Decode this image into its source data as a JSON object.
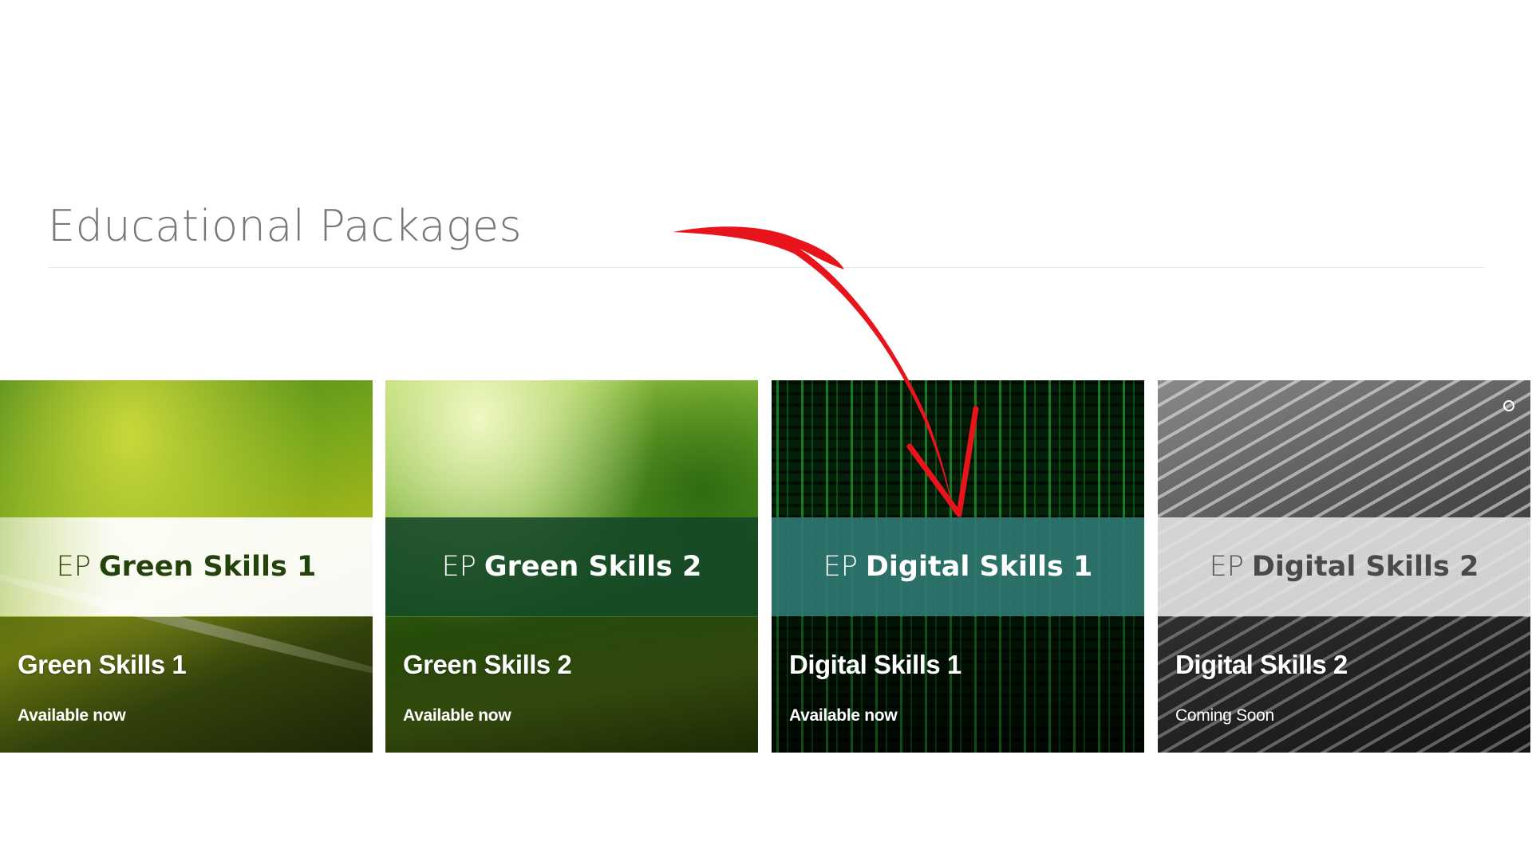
{
  "section": {
    "title": "Educational Packages"
  },
  "cards": [
    {
      "band_prefix": "EP",
      "band_name": "Green Skills 1",
      "title": "Green Skills 1",
      "status": "Available now"
    },
    {
      "band_prefix": "EP",
      "band_name": "Green Skills 2",
      "title": "Green Skills 2",
      "status": "Available now"
    },
    {
      "band_prefix": "EP",
      "band_name": "Digital Skills 1",
      "title": "Digital Skills 1",
      "status": "Available now"
    },
    {
      "band_prefix": "EP",
      "band_name": "Digital Skills 2",
      "title": "Digital Skills 2",
      "status": "Coming Soon"
    }
  ],
  "colors": {
    "title_gray": "#777777",
    "green_skills_1_band": "#ffffff",
    "green_skills_2_band": "#124628",
    "digital_skills_1_band": "#2e7670",
    "digital_skills_2_band": "#e1e1e1",
    "annotation_arrow": "#e8141c"
  },
  "annotation": {
    "icon": "red-arrow-icon",
    "points_to": "Digital Skills 1"
  }
}
